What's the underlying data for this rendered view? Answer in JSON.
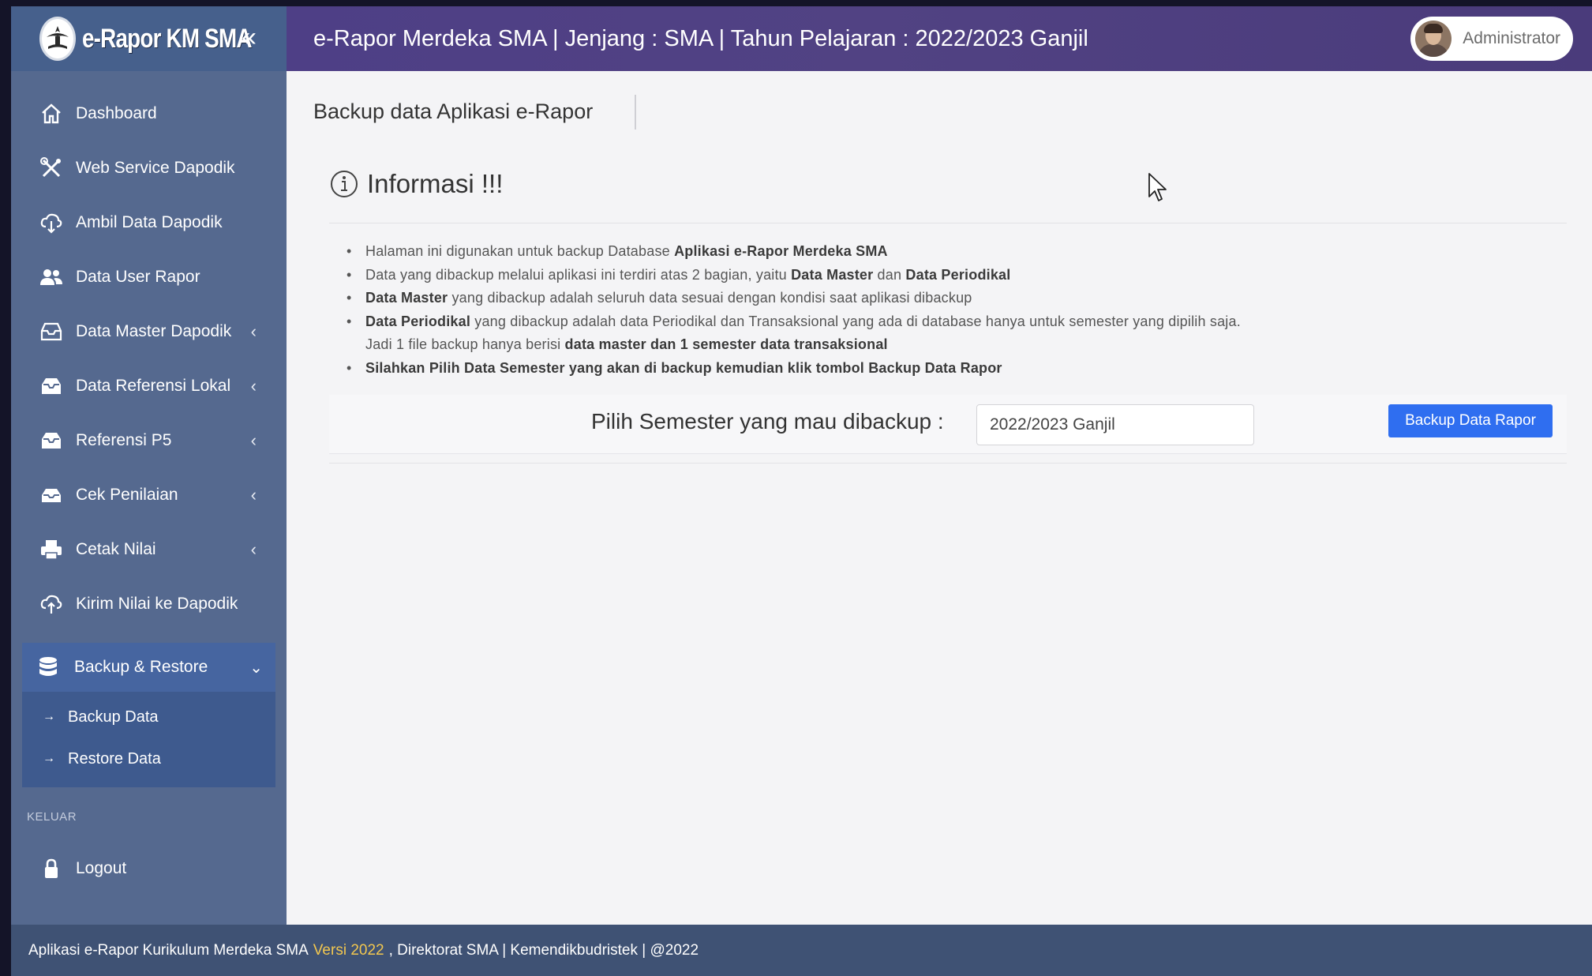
{
  "app": {
    "logo_text": "e-Rapor KM SMA",
    "header_title": "e-Rapor Merdeka SMA | Jenjang : SMA | Tahun Pelajaran : 2022/2023 Ganjil",
    "user_name": "Administrator"
  },
  "sidebar": {
    "items": [
      {
        "label": "Dashboard",
        "icon": "home-icon"
      },
      {
        "label": "Web Service Dapodik",
        "icon": "tools-icon"
      },
      {
        "label": "Ambil Data Dapodik",
        "icon": "cloud-download-icon"
      },
      {
        "label": "Data User Rapor",
        "icon": "users-icon"
      },
      {
        "label": "Data Master Dapodik",
        "icon": "inbox-icon",
        "chevron": "‹"
      },
      {
        "label": "Data Referensi Lokal",
        "icon": "inbox-icon",
        "chevron": "‹"
      },
      {
        "label": "Referensi P5",
        "icon": "inbox-icon",
        "chevron": "‹"
      },
      {
        "label": "Cek Penilaian",
        "icon": "inbox-icon",
        "chevron": "‹"
      },
      {
        "label": "Cetak Nilai",
        "icon": "printer-icon",
        "chevron": "‹"
      },
      {
        "label": "Kirim Nilai ke Dapodik",
        "icon": "cloud-upload-icon"
      }
    ],
    "backup_group": {
      "label": "Backup & Restore",
      "icon": "database-icon",
      "chevron": "⌄",
      "sub_items": [
        {
          "label": "Backup Data"
        },
        {
          "label": "Restore Data"
        }
      ]
    },
    "section_keluar": "KELUAR",
    "logout_label": "Logout"
  },
  "main": {
    "page_title": "Backup data Aplikasi e-Rapor",
    "info_title": "Informasi !!!",
    "info_items": [
      [
        {
          "t": "Halaman ini digunakan untuk backup Database "
        },
        {
          "t": "Aplikasi e-Rapor Merdeka SMA",
          "b": true
        }
      ],
      [
        {
          "t": "Data yang dibackup melalui aplikasi ini terdiri atas 2 bagian, yaitu "
        },
        {
          "t": "Data Master",
          "b": true
        },
        {
          "t": " dan "
        },
        {
          "t": "Data Periodikal",
          "b": true
        }
      ],
      [
        {
          "t": "Data Master",
          "b": true
        },
        {
          "t": " yang dibackup adalah seluruh data sesuai dengan kondisi saat aplikasi dibackup"
        }
      ],
      [
        {
          "t": "Data Periodikal",
          "b": true
        },
        {
          "t": " yang dibackup adalah data Periodikal dan Transaksional yang ada di database hanya untuk semester yang dipilih saja."
        },
        {
          "br": true
        },
        {
          "t": "Jadi 1 file backup hanya berisi "
        },
        {
          "t": "data master dan 1 semester data transaksional",
          "b": true
        }
      ],
      [
        {
          "t": "Silahkan Pilih Data Semester yang akan di backup kemudian klik tombol Backup Data Rapor",
          "b": true
        }
      ]
    ],
    "form_label": "Pilih Semester yang mau dibackup :",
    "semester_value": "2022/2023 Ganjil",
    "backup_button": "Backup Data Rapor"
  },
  "footer": {
    "text_before": "Aplikasi e-Rapor Kurikulum Merdeka SMA",
    "version": "Versi 2022",
    "text_after": ", Direktorat SMA | Kemendikbudristek | @2022"
  },
  "colors": {
    "sidebar_bg": "#55698f",
    "header_bg": "#4e3f86",
    "active_group": "#3e5a8e",
    "button_blue": "#2f6ef0",
    "version_yellow": "#f2c74f"
  }
}
